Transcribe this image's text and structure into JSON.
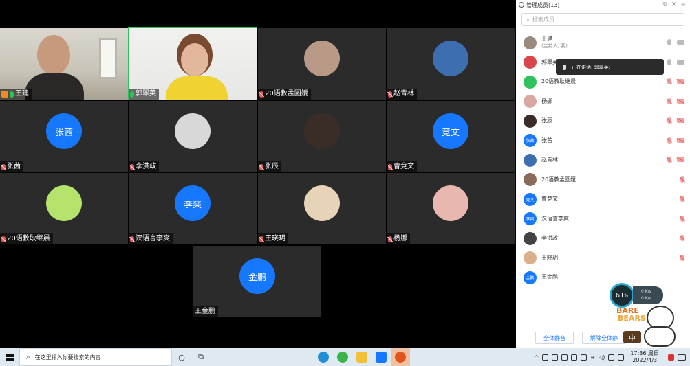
{
  "panel": {
    "title": "管理成员(13)",
    "search_placeholder": "搜索成员",
    "speaking_tip": "正在讲话: 郭翠英;",
    "mute_all_label": "全体静音",
    "unmute_all_label": "解除全体静"
  },
  "tiles": [
    {
      "name": "王建",
      "type": "video",
      "mic": "on",
      "host": true
    },
    {
      "name": "郭翠英",
      "type": "video",
      "mic": "on",
      "speaking": true
    },
    {
      "name": "20语教孟圆媛",
      "type": "photo",
      "mic": "off"
    },
    {
      "name": "赵青林",
      "type": "photo",
      "mic": "off"
    },
    {
      "name": "张茜",
      "type": "text",
      "avatar_text": "张茜",
      "mic": "off"
    },
    {
      "name": "李洪政",
      "type": "photo",
      "mic": "off"
    },
    {
      "name": "张辰",
      "type": "photo",
      "mic": "off"
    },
    {
      "name": "曹竞文",
      "type": "text",
      "avatar_text": "竞文",
      "mic": "off"
    },
    {
      "name": "20语教耿继晨",
      "type": "photo",
      "mic": "off"
    },
    {
      "name": "汉语言李爽",
      "type": "text",
      "avatar_text": "李爽",
      "mic": "off"
    },
    {
      "name": "王晓玥",
      "type": "photo",
      "mic": "off"
    },
    {
      "name": "杨娜",
      "type": "photo",
      "mic": "off"
    },
    {
      "name": "王金鹏",
      "type": "text",
      "avatar_text": "金鹏",
      "mic": "none"
    }
  ],
  "members": [
    {
      "name": "王建",
      "sub": "(主持人, 我)",
      "avatar": "photo",
      "mic": "grey",
      "cam": "grey"
    },
    {
      "name": "郭翠英",
      "avatar": "photo",
      "mic": "grey",
      "cam": "grey"
    },
    {
      "name": "20语教耿继晨",
      "avatar": "photo",
      "mic": "red",
      "cam": "red"
    },
    {
      "name": "杨娜",
      "avatar": "photo",
      "mic": "red",
      "cam": "red"
    },
    {
      "name": "张辰",
      "avatar": "photo",
      "mic": "red",
      "cam": "red"
    },
    {
      "name": "张茜",
      "avatar": "text",
      "avatar_text": "张茜",
      "mic": "red",
      "cam": "red"
    },
    {
      "name": "赵青林",
      "avatar": "photo",
      "mic": "red",
      "cam": "red"
    },
    {
      "name": "20语教孟圆媛",
      "avatar": "photo",
      "mic": "red",
      "cam": "none"
    },
    {
      "name": "曹竞文",
      "avatar": "text",
      "avatar_text": "竞文",
      "mic": "red",
      "cam": "none"
    },
    {
      "name": "汉语言李爽",
      "avatar": "text",
      "avatar_text": "李爽",
      "mic": "red",
      "cam": "none"
    },
    {
      "name": "李洪政",
      "avatar": "photo",
      "mic": "red",
      "cam": "none"
    },
    {
      "name": "王晓玥",
      "avatar": "photo",
      "mic": "red",
      "cam": "none"
    },
    {
      "name": "王金鹏",
      "avatar": "text",
      "avatar_text": "金鹏",
      "mic": "none",
      "cam": "none"
    }
  ],
  "widget": {
    "percent": "61",
    "percent_unit": "%",
    "up": "0 K/s",
    "down": "0 K/s",
    "brand_line1": "BARE",
    "brand_line2": "BEARS",
    "ime": "中"
  },
  "taskbar": {
    "search_placeholder": "在这里输入你要搜索的内容",
    "time": "17:36 周日",
    "date": "2022/4/3"
  },
  "colors": {
    "accent": "#1677ff",
    "speaking": "#2fc15b",
    "muted": "#e05a5a",
    "tile_bg": "#2b2b2b"
  }
}
